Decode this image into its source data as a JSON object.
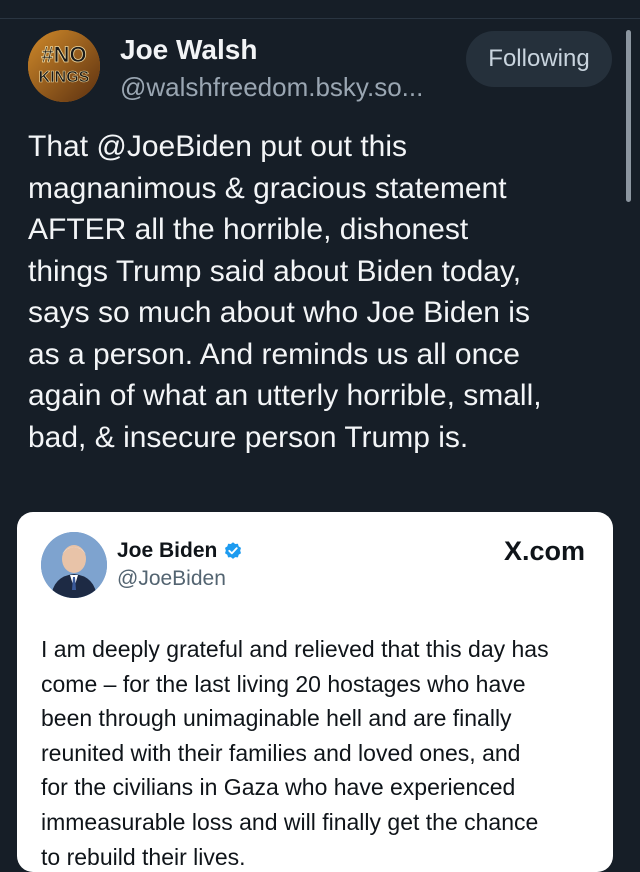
{
  "post": {
    "author": {
      "display_name": "Joe Walsh",
      "handle": "@walshfreedom.bsky.so...",
      "avatar_text_top": "#NO",
      "avatar_text_bottom": "KINGS"
    },
    "follow_button_label": "Following",
    "text": "That @JoeBiden put out this\nmagnanimous & gracious statement\nAFTER all the horrible, dishonest\nthings Trump said about Biden today,\nsays so much about who Joe Biden is\nas a person. And reminds us all once\nagain of what an utterly horrible, small,\nbad, & insecure person Trump is.",
    "embed": {
      "display_name": "Joe Biden",
      "handle": "@JoeBiden",
      "source_label": "X.com",
      "text": "I am deeply grateful and relieved that this day has\ncome – for the last living 20 hostages who have\nbeen through unimaginable hell and are finally\nreunited with their families and loved ones, and\nfor the civilians in Gaza who have experienced\nimmeasurable loss and will finally get the chance\nto rebuild their lives."
    }
  },
  "colors": {
    "background": "#161e27",
    "follow_button_bg": "#25303b",
    "verified_badge": "#1d9bf0"
  },
  "icons": {
    "verified": "verified-badge-icon"
  }
}
